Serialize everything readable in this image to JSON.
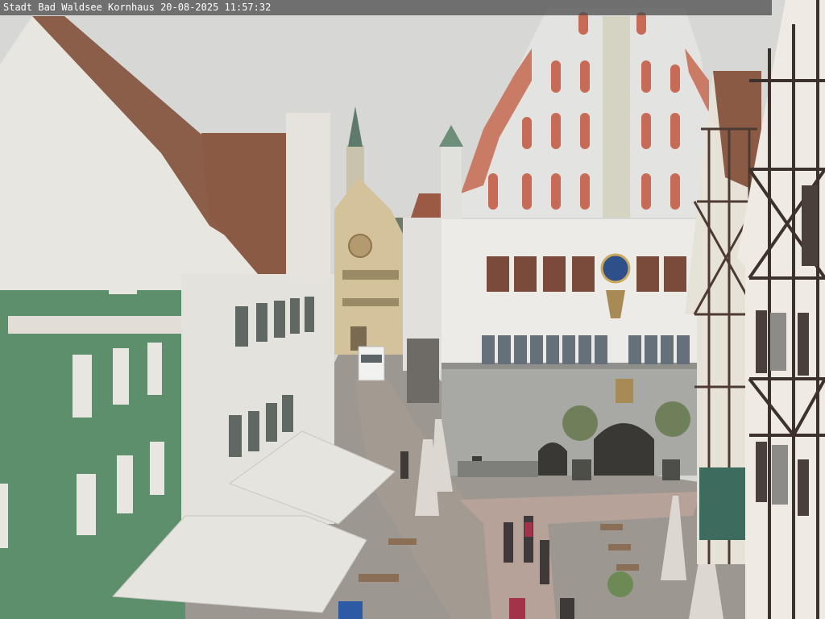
{
  "overlay": {
    "caption": "Stadt Bad Waldsee Kornhaus 20-08-2025 11:57:32"
  },
  "colors": {
    "sky": "#d7d8d6",
    "green_house": "#5e8f6c",
    "roof": "#8a5a44",
    "white_wall": "#e8e6e1",
    "townhall": "#e5e5e3",
    "gothic_window": "#c76a56",
    "stone_base": "#a8a8a4",
    "pavement": "#9c9891",
    "awning": "#e6e4df",
    "timber": "#3c312b"
  }
}
